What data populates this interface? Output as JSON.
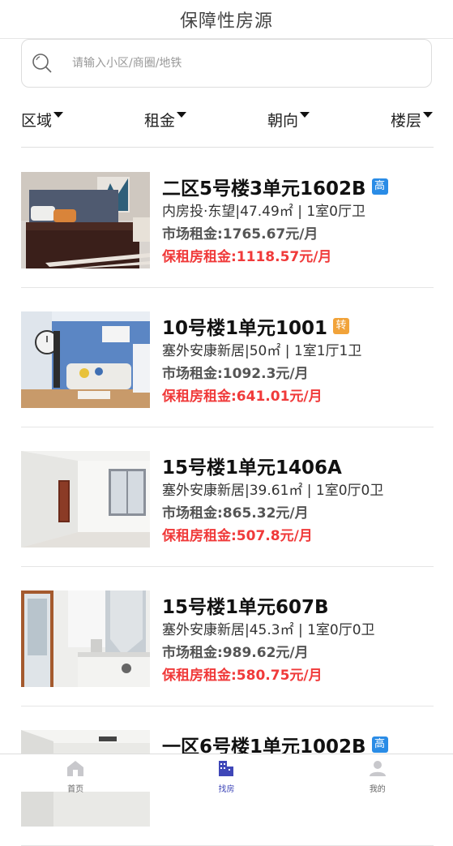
{
  "header": {
    "title": "保障性房源"
  },
  "search": {
    "placeholder": "请输入小区/商圈/地铁"
  },
  "filters": [
    {
      "label": "区域"
    },
    {
      "label": "租金"
    },
    {
      "label": "朝向"
    },
    {
      "label": "楼层"
    }
  ],
  "listings": [
    {
      "name": "二区5号楼3单元1602B",
      "tag": "高",
      "tag_color": "#2a8ce6",
      "desc": "内房投·东望|47.49㎡ | 1室0厅卫",
      "market_rent": "市场租金:1765.67元/月",
      "protected_rent": "保租房租金:1118.57元/月",
      "photo": "bedroom-photo"
    },
    {
      "name": "10号楼1单元1001",
      "tag": "转",
      "tag_color": "#f1a33a",
      "desc": "塞外安康新居|50㎡ | 1室1厅1卫",
      "market_rent": "市场租金:1092.3元/月",
      "protected_rent": "保租房租金:641.01元/月",
      "photo": "living-room-photo"
    },
    {
      "name": "15号楼1单元1406A",
      "tag": "",
      "tag_color": "",
      "desc": "塞外安康新居|39.61㎡ | 1室0厅0卫",
      "market_rent": "市场租金:865.32元/月",
      "protected_rent": "保租房租金:507.8元/月",
      "photo": "empty-room-photo"
    },
    {
      "name": "15号楼1单元607B",
      "tag": "",
      "tag_color": "",
      "desc": "塞外安康新居|45.3㎡ | 1室0厅0卫",
      "market_rent": "市场租金:989.62元/月",
      "protected_rent": "保租房租金:580.75元/月",
      "photo": "kitchen-photo"
    },
    {
      "name": "一区6号楼1单元1002B",
      "tag": "高",
      "tag_color": "#2a8ce6",
      "desc": "",
      "market_rent": "",
      "protected_rent": "",
      "photo": "room-photo"
    }
  ],
  "tabbar": [
    {
      "label": "首页",
      "icon": "home-icon",
      "active": false
    },
    {
      "label": "找房",
      "icon": "building-icon",
      "active": true
    },
    {
      "label": "我的",
      "icon": "user-icon",
      "active": false
    }
  ],
  "colors": {
    "accent": "#3f47b8",
    "rent_red": "#f03a3a",
    "tag_blue": "#2a8ce6",
    "tag_orange": "#f1a33a"
  }
}
